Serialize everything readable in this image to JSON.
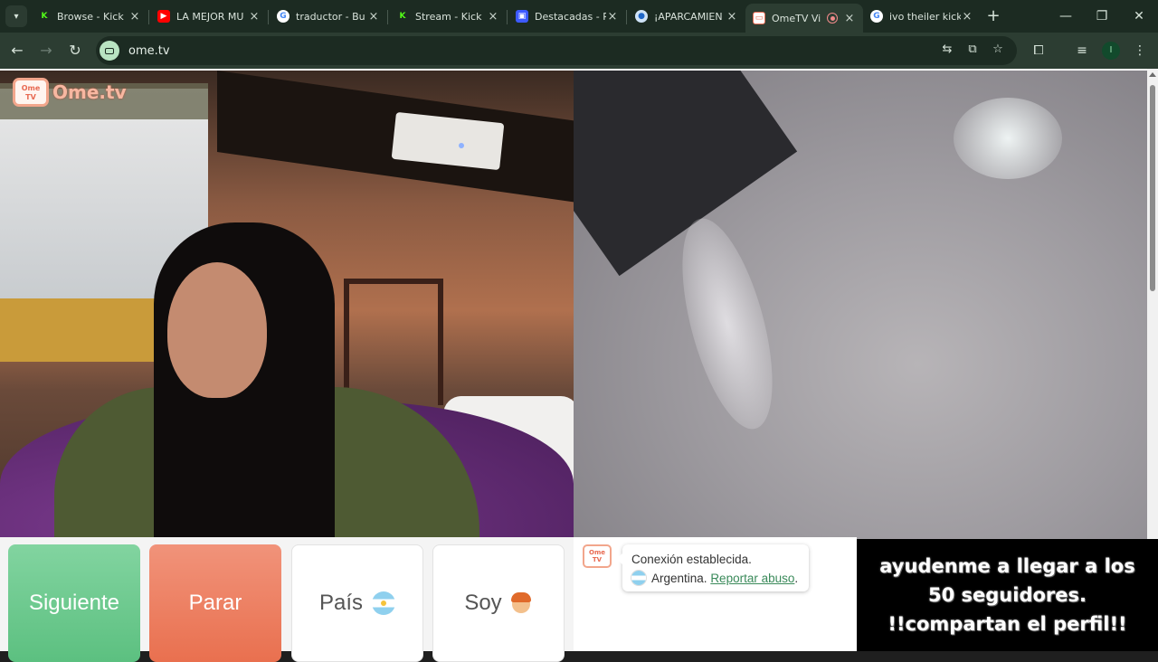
{
  "browser": {
    "tabs": [
      {
        "title": "Browse - Kick",
        "favicon": "kick-icon",
        "active": false
      },
      {
        "title": "LA MEJOR MU",
        "favicon": "youtube-icon",
        "active": false
      },
      {
        "title": "traductor - Bu",
        "favicon": "google-icon",
        "active": false
      },
      {
        "title": "Stream - Kick",
        "favicon": "kick-icon",
        "active": false
      },
      {
        "title": "Destacadas - P",
        "favicon": "doc-icon",
        "active": false
      },
      {
        "title": "¡APARCAMIEN",
        "favicon": "circle-icon",
        "active": false
      },
      {
        "title": "OmeTV Vi",
        "favicon": "ometv-icon",
        "active": true
      },
      {
        "title": "ivo theiler kick",
        "favicon": "google-icon",
        "active": false
      }
    ],
    "url": "ome.tv",
    "profile_initial": "I"
  },
  "site": {
    "logo_text": "Ome.tv",
    "logo_badge": "Ome TV"
  },
  "controls": {
    "next_label": "Siguiente",
    "stop_label": "Parar",
    "country_label": "País",
    "gender_label": "Soy"
  },
  "chat": {
    "status": "Conexión establecida.",
    "country": "Argentina.",
    "report_link": "Reportar abuso",
    "report_suffix": "."
  },
  "overlay": {
    "line1": "ayudenme a llegar a los",
    "line2": "50 seguidores.",
    "line3": "!!compartan el perfil!!"
  }
}
